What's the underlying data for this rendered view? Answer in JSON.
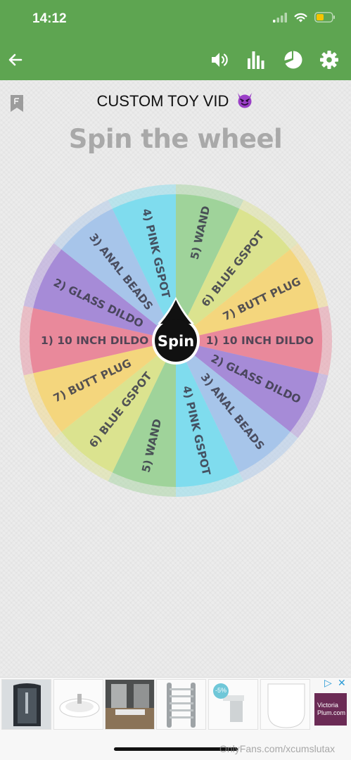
{
  "status_bar": {
    "time": "14:12",
    "icons": [
      "signal-icon",
      "wifi-icon",
      "battery-icon"
    ],
    "battery_color": "#f5c400"
  },
  "toolbar": {
    "back_icon": "back-arrow-icon",
    "actions": [
      "sound-icon",
      "stats-icon",
      "pie-chart-icon",
      "settings-icon"
    ],
    "color": "#5ea551"
  },
  "header": {
    "title": "CUSTOM TOY VID",
    "title_emoji": "😈",
    "subtitle": "Spin the wheel"
  },
  "wheel": {
    "spin_label": "Spin",
    "segments": [
      {
        "label": "1) 10 INCH DILDO",
        "color": "#e9899b"
      },
      {
        "label": "2) GLASS DILDO",
        "color": "#a68bd7"
      },
      {
        "label": "3) ANAL BEADS",
        "color": "#a7c5ea"
      },
      {
        "label": "4) PINK GSPOT",
        "color": "#7fdcee"
      },
      {
        "label": "5) WAND",
        "color": "#9fd39a"
      },
      {
        "label": "6) BLUE GSPOT",
        "color": "#dbe38f"
      },
      {
        "label": "7) BUTT PLUG",
        "color": "#f4d67d"
      },
      {
        "label": "1) 10 INCH DILDO",
        "color": "#e9899b"
      },
      {
        "label": "2) GLASS DILDO",
        "color": "#a68bd7"
      },
      {
        "label": "3) ANAL BEADS",
        "color": "#a7c5ea"
      },
      {
        "label": "4) PINK GSPOT",
        "color": "#7fdcee"
      },
      {
        "label": "5) WAND",
        "color": "#9fd39a"
      },
      {
        "label": "6) BLUE GSPOT",
        "color": "#dbe38f"
      },
      {
        "label": "7) BUTT PLUG",
        "color": "#f4d67d"
      }
    ]
  },
  "ad": {
    "items": [
      "shower-enclosure",
      "wash-basin",
      "bathroom-suite",
      "towel-rail",
      "basin-tap",
      "toilet-seat"
    ],
    "badge": "-5%",
    "brand": "Victoria Plum.com"
  },
  "watermark": "OnlyFans.com/xcumslutax"
}
